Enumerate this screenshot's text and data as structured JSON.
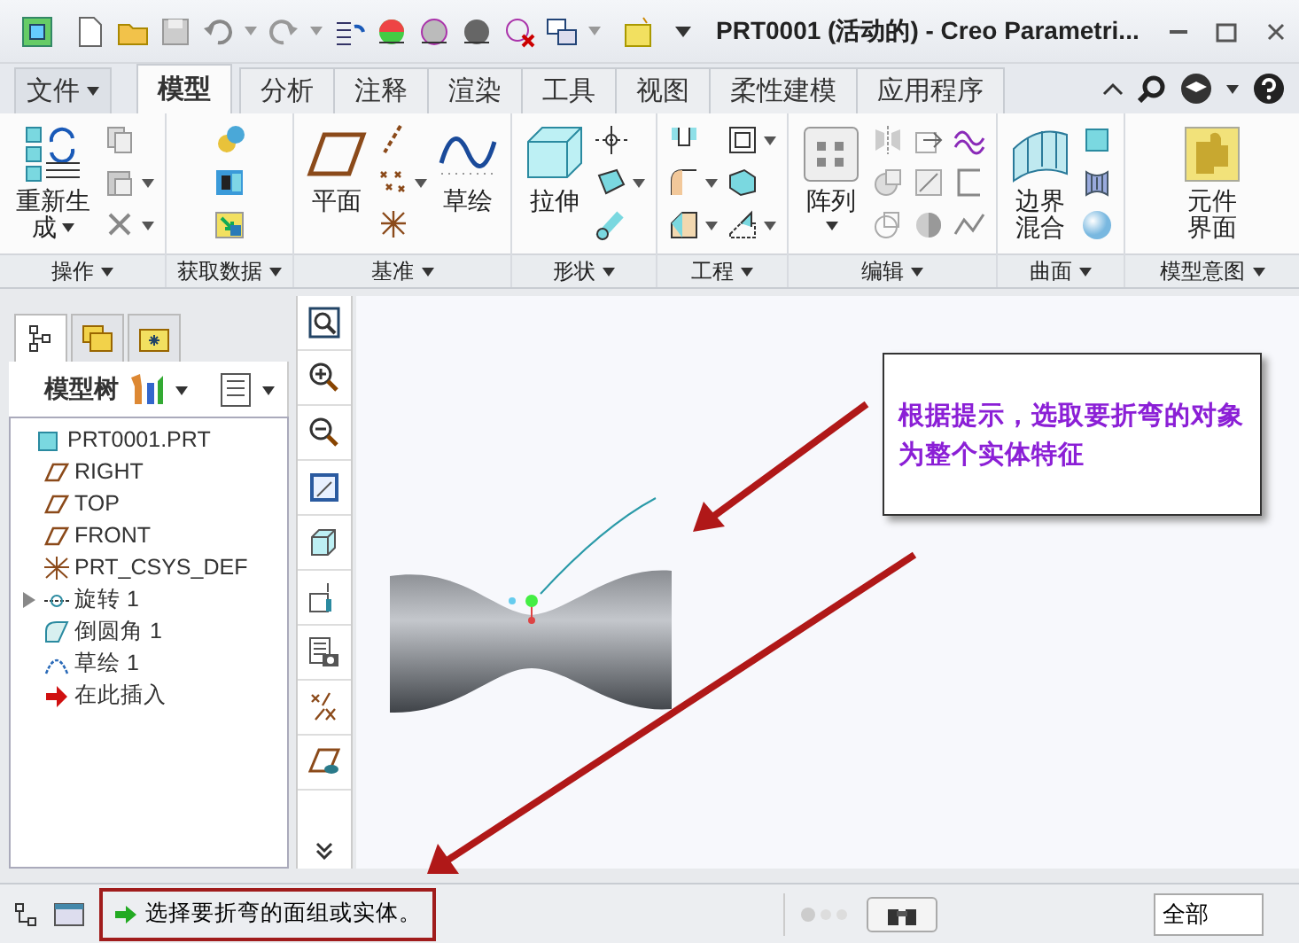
{
  "window": {
    "title": "PRT0001 (活动的) - Creo Parametri..."
  },
  "tabs": [
    {
      "label": "文件",
      "kind": "menu",
      "selected": false
    },
    {
      "label": "模型",
      "kind": "tab",
      "selected": true
    },
    {
      "label": "分析",
      "kind": "tab",
      "selected": false
    },
    {
      "label": "注释",
      "kind": "tab",
      "selected": false
    },
    {
      "label": "渲染",
      "kind": "tab",
      "selected": false
    },
    {
      "label": "工具",
      "kind": "tab",
      "selected": false
    },
    {
      "label": "视图",
      "kind": "tab",
      "selected": false
    },
    {
      "label": "柔性建模",
      "kind": "tab",
      "selected": false
    },
    {
      "label": "应用程序",
      "kind": "tab",
      "selected": false
    }
  ],
  "ribbon": {
    "groups": [
      {
        "name": "操作",
        "buttons": [
          {
            "label": "重新生成"
          }
        ]
      },
      {
        "name": "获取数据"
      },
      {
        "name": "基准",
        "buttons": [
          {
            "label": "平面"
          },
          {
            "label": "草绘"
          }
        ]
      },
      {
        "name": "形状",
        "buttons": [
          {
            "label": "拉伸"
          }
        ]
      },
      {
        "name": "工程"
      },
      {
        "name": "编辑",
        "buttons": [
          {
            "label": "阵列"
          }
        ]
      },
      {
        "name": "曲面",
        "buttons": [
          {
            "label": "边界混合"
          }
        ]
      },
      {
        "name": "模型意图",
        "buttons": [
          {
            "label": "元件界面"
          }
        ]
      }
    ]
  },
  "model_tree": {
    "title": "模型树",
    "items": [
      {
        "label": "PRT0001.PRT",
        "kind": "part",
        "children": [
          {
            "label": "RIGHT",
            "kind": "plane"
          },
          {
            "label": "TOP",
            "kind": "plane"
          },
          {
            "label": "FRONT",
            "kind": "plane"
          },
          {
            "label": "PRT_CSYS_DEF",
            "kind": "csys"
          },
          {
            "label": "旋转 1",
            "kind": "revolve",
            "expanded": false
          },
          {
            "label": "倒圆角 1",
            "kind": "round"
          },
          {
            "label": "草绘 1",
            "kind": "sketch"
          },
          {
            "label": "在此插入",
            "kind": "insert"
          }
        ]
      }
    ]
  },
  "callout": {
    "text": "根据提示，选取要折弯的对象为整个实体特征",
    "color": "#8b1fd6"
  },
  "status_bar": {
    "message": "选择要折弯的面组或实体。",
    "highlighted": true,
    "filter": "全部"
  }
}
